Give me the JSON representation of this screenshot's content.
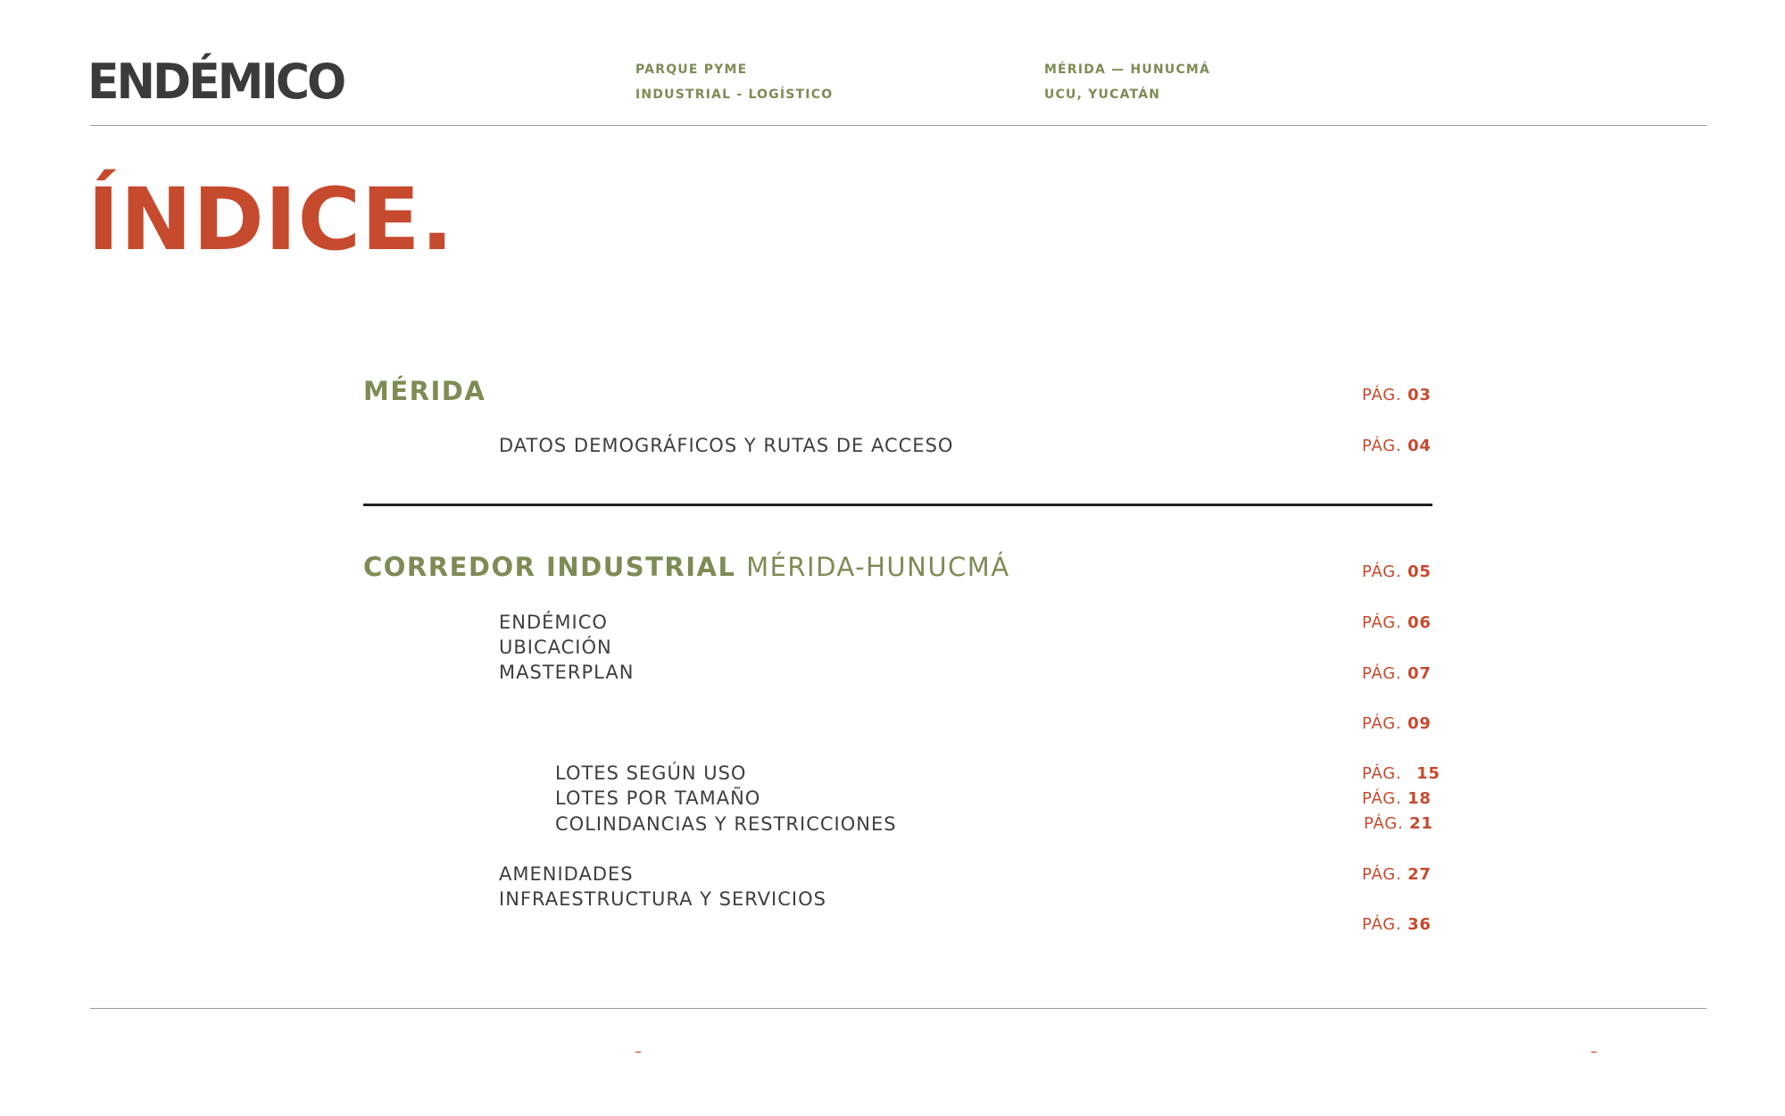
{
  "header": {
    "brand": "ENDÉMICO",
    "project_line1": "PARQUE PYME",
    "project_line2": "INDUSTRIAL - LOGÍSTICO",
    "location_line1": "MÉRIDA — HUNUCMÁ",
    "location_line2": "UCU, YUCATÁN"
  },
  "title": "ÍNDICE.",
  "sections": {
    "merida": {
      "title": "MÉRIDA",
      "page_prefix": "PÁG.",
      "page": "03",
      "item1": "DATOS DEMOGRÁFICOS Y RUTAS DE ACCESO",
      "item1_page": "04"
    },
    "corredor": {
      "title_bold": "CORREDOR INDUSTRIAL",
      "title_light": "MÉRIDA-HUNUCMÁ",
      "page": "05",
      "items": [
        "ENDÉMICO",
        "UBICACIÓN",
        "MASTERPLAN"
      ],
      "subitems": [
        "LOTES SEGÚN USO",
        "LOTES POR TAMAÑO",
        "COLINDANCIAS Y RESTRICCIONES"
      ],
      "items2": [
        "AMENIDADES",
        "INFRAESTRUCTURA Y SERVICIOS"
      ],
      "pages": [
        "06",
        "07",
        "09",
        "15",
        "18",
        "21",
        "27",
        "36"
      ]
    }
  },
  "footer": {
    "dash_left": "–",
    "dash_right": "–"
  }
}
